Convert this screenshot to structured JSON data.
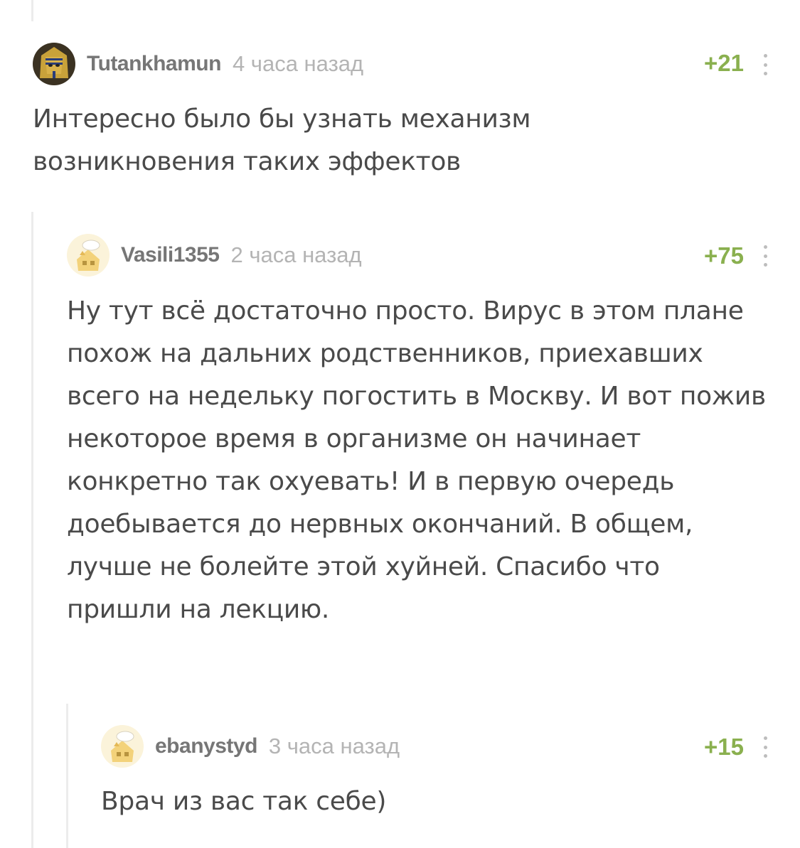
{
  "comments": [
    {
      "avatar": "pharaoh-mask-avatar",
      "username": "Tutankhamun",
      "time": "4 часа назад",
      "rating": "+21",
      "text": "Интересно было бы узнать механизм возникновения таких эффектов"
    },
    {
      "avatar": "default-avatar",
      "username": "Vasili1355",
      "time": "2 часа назад",
      "rating": "+75",
      "text": "Ну тут всё достаточно просто. Вирус в этом плане похож на дальних родственников, приехавших всего на недельку погостить в Москву. И вот пожив некоторое время в организме он начинает конкретно так охуевать! И в первую очередь доебывается до нервных окончаний. В общем, лучше не болейте этой хуйней. Спасибо что пришли на лекцию."
    },
    {
      "avatar": "default-avatar",
      "username": "ebanystyd",
      "time": "3 часа назад",
      "rating": "+15",
      "text": "Врач из вас так себе)"
    }
  ],
  "colors": {
    "rating": "#8ab04f",
    "username": "#767676",
    "time": "#b4b4b4",
    "text": "#4a4a4a",
    "thread_line": "#ececec"
  }
}
